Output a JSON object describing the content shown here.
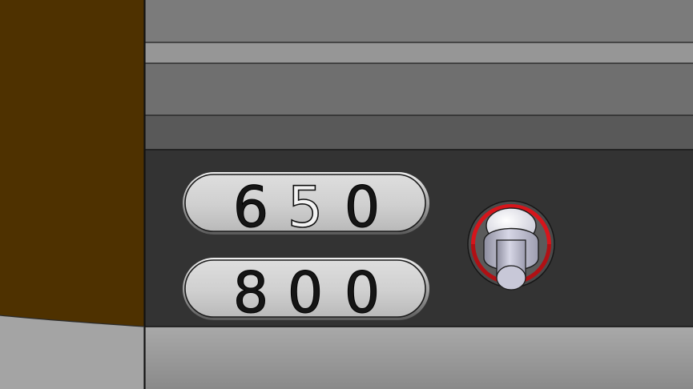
{
  "lock_panel": {
    "display_rows": [
      {
        "digits": [
          "6",
          "5",
          "0"
        ]
      },
      {
        "digits": [
          "8",
          "0",
          "0"
        ]
      }
    ]
  },
  "colors": {
    "side_post": "#4e3100",
    "panel_dark": "#333333",
    "top_band": "#7b7b7b",
    "shelf_light": "#969696",
    "shelf_mid": "#6f6f6f",
    "shelf_dark": "#595959",
    "floor": "#8e8e8e",
    "window_face": "#d3d3d3",
    "knob_accent": "#d6151b"
  }
}
